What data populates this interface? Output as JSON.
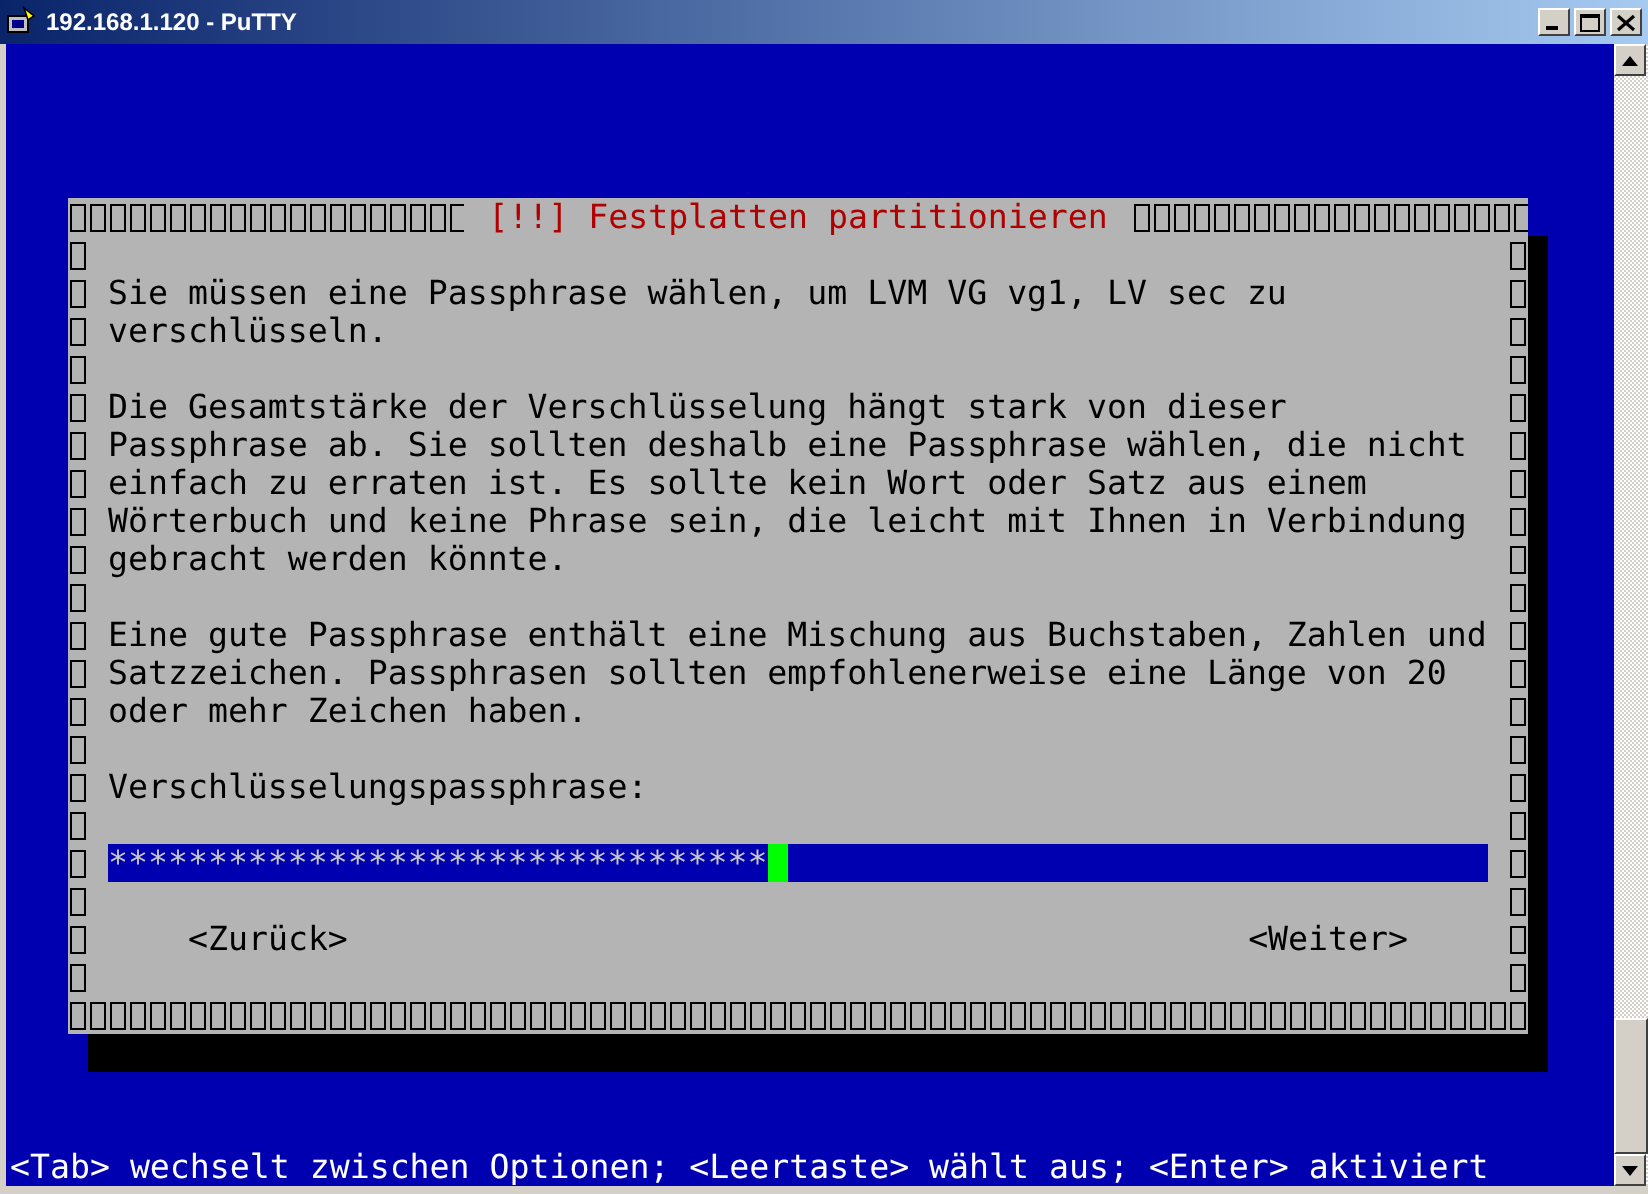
{
  "window": {
    "title": "192.168.1.120 - PuTTY"
  },
  "dialog": {
    "title": "[!!] Festplatten partitionieren",
    "paragraphs": [
      "Sie müssen eine Passphrase wählen, um LVM VG vg1, LV sec zu verschlüsseln.",
      "Die Gesamtstärke der Verschlüsselung hängt stark von dieser Passphrase ab. Sie sollten deshalb eine Passphrase wählen, die nicht einfach zu erraten ist. Es sollte kein Wort oder Satz aus einem Wörterbuch und keine Phrase sein, die leicht mit Ihnen in Verbindung gebracht werden könnte.",
      "Eine gute Passphrase enthält eine Mischung aus Buchstaben, Zahlen und Satzzeichen. Passphrasen sollten empfohlenerweise eine Länge von 20 oder mehr Zeichen haben."
    ],
    "prompt": "Verschlüsselungspassphrase:",
    "password_field": {
      "value": "*********************************"
    },
    "buttons": [
      "<Zurück>",
      "<Weiter>"
    ]
  },
  "status_bar": "<Tab> wechselt zwischen Optionen; <Leertaste> wählt aus; <Enter> aktiviert"
}
